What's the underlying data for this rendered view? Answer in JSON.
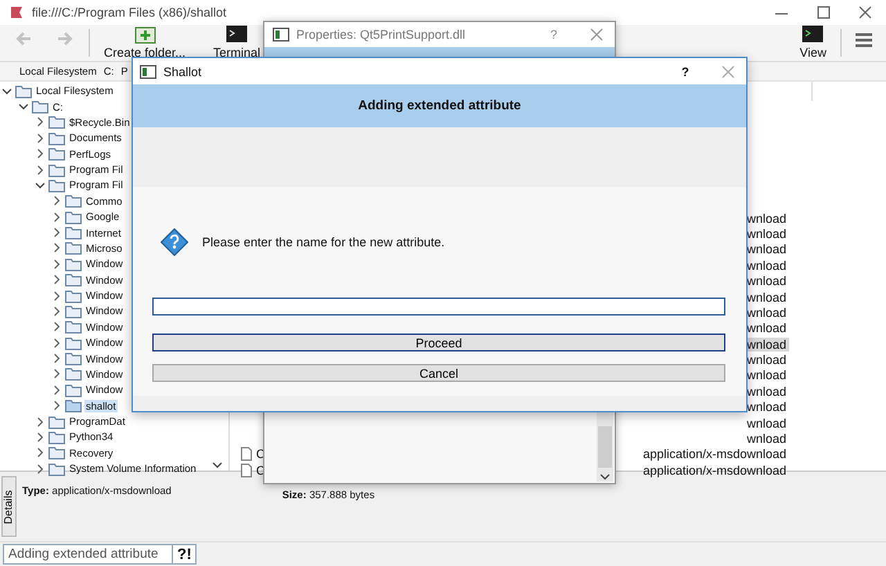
{
  "window": {
    "title": "file:///C:/Program Files (x86)/shallot"
  },
  "nav_buttons": [
    {
      "kind": "back",
      "disabled": true
    },
    {
      "kind": "forward",
      "disabled": true
    }
  ],
  "toolbar_buttons": [
    {
      "kind": "folder",
      "label": "Create folder..."
    },
    {
      "kind": "terminal",
      "label": "Terminal"
    },
    {
      "kind": "view",
      "label": "View"
    }
  ],
  "breadcrumb": [
    "Local Filesystem",
    "C:",
    "P"
  ],
  "tree": [
    {
      "label": "Local Filesystem",
      "expanded": true,
      "selected": false,
      "children": [
        {
          "label": "C:",
          "expanded": true,
          "selected": false,
          "children": [
            {
              "label": "$Recycle.Bin",
              "expanded": false,
              "selected": false
            },
            {
              "label": "Documents",
              "expanded": false,
              "selected": false
            },
            {
              "label": "PerfLogs",
              "expanded": false,
              "selected": false
            },
            {
              "label": "Program Fil",
              "expanded": false,
              "selected": false
            },
            {
              "label": "Program Fil",
              "expanded": true,
              "selected": false,
              "children": [
                {
                  "label": "Commo",
                  "expanded": false,
                  "selected": false
                },
                {
                  "label": "Google",
                  "expanded": false,
                  "selected": false
                },
                {
                  "label": "Internet",
                  "expanded": false,
                  "selected": false
                },
                {
                  "label": "Microso",
                  "expanded": false,
                  "selected": false
                },
                {
                  "label": "Window",
                  "expanded": false,
                  "selected": false
                },
                {
                  "label": "Window",
                  "expanded": false,
                  "selected": false
                },
                {
                  "label": "Window",
                  "expanded": false,
                  "selected": false
                },
                {
                  "label": "Window",
                  "expanded": false,
                  "selected": false
                },
                {
                  "label": "Window",
                  "expanded": false,
                  "selected": false
                },
                {
                  "label": "Window",
                  "expanded": false,
                  "selected": false
                },
                {
                  "label": "Window",
                  "expanded": false,
                  "selected": false
                },
                {
                  "label": "Window",
                  "expanded": false,
                  "selected": false
                },
                {
                  "label": "Window",
                  "expanded": false,
                  "selected": false
                },
                {
                  "label": "shallot",
                  "expanded": false,
                  "selected": true
                }
              ]
            },
            {
              "label": "ProgramDat",
              "expanded": false,
              "selected": false
            },
            {
              "label": "Python34",
              "expanded": false,
              "selected": false
            },
            {
              "label": "Recovery",
              "expanded": false,
              "selected": false
            },
            {
              "label": "System Volume Information",
              "expanded": false,
              "selected": false
            }
          ]
        }
      ]
    }
  ],
  "files": [
    {
      "type": "wnload",
      "selected": false
    },
    {
      "type": "wnload",
      "selected": false
    },
    {
      "type": "wnload",
      "selected": false
    },
    {
      "type": "wnload",
      "selected": false
    },
    {
      "type": "wnload",
      "selected": false
    },
    {
      "type": "wnload",
      "selected": false
    },
    {
      "type": "wnload",
      "selected": false
    },
    {
      "type": "wnload",
      "selected": false
    },
    {
      "type": "wnload",
      "selected": true
    },
    {
      "type": "wnload",
      "selected": false
    },
    {
      "type": "wnload",
      "selected": false
    },
    {
      "type": "wnload",
      "selected": false
    },
    {
      "type": "wnload",
      "selected": false
    },
    {
      "type": "wnload",
      "selected": false
    },
    {
      "type": "wnload",
      "selected": false
    },
    {
      "name": "C",
      "type": "application/x-msdownload",
      "selected": false
    },
    {
      "name": "C",
      "type": "application/x-msdownload",
      "selected": false
    }
  ],
  "details": {
    "tab": "Details",
    "type": "**Type:** application/x-msdownload",
    "size": "**Size:** 357.888 bytes"
  },
  "status_bar": {
    "message": "Adding extended attribute",
    "button": "?!"
  },
  "properties_dialog": {
    "title": "Properties: Qt5PrintSupport.dll",
    "help": "?"
  },
  "shallot_dialog": {
    "title": "Shallot",
    "help": "?",
    "header": "Adding extended attribute",
    "prompt": "Please enter the name for the new attribute.",
    "input_focused": true,
    "buttons": [
      {
        "label": "Proceed",
        "focused": true
      },
      {
        "label": "Cancel",
        "focused": false
      }
    ]
  }
}
